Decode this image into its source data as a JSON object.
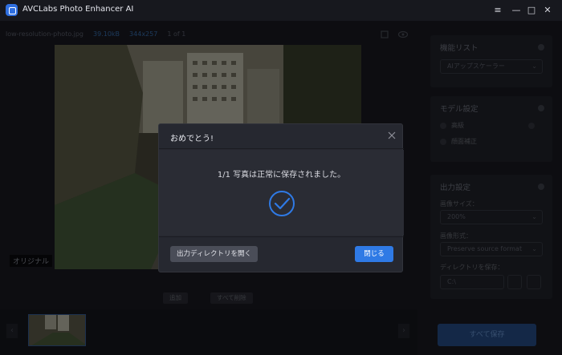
{
  "app": {
    "title": "AVCLabs Photo Enhancer AI"
  },
  "window": {
    "menu_icon": "hamburger-icon",
    "minimize_icon": "minimize-icon",
    "maximize_icon": "maximize-icon",
    "close_icon": "close-icon"
  },
  "file": {
    "name": "low-resolution-photo.jpg",
    "size": "39.10kB",
    "dimensions": "344x257",
    "page": "1 of 1"
  },
  "preview": {
    "label": "オリジナル"
  },
  "actions": {
    "add": "追加",
    "delete_all": "すべて削除"
  },
  "panel": {
    "model_list": {
      "title": "機能リスト",
      "selected": "AIアップスケーラー"
    },
    "model_settings": {
      "title": "モデル設定",
      "options": [
        "高級",
        "顔面補正"
      ]
    },
    "output": {
      "title": "出力設定",
      "scale_label": "画像サイズ：",
      "scale_value": "200%",
      "format_label": "画像形式：",
      "format_value": "Preserve source format",
      "dir_label": "ディレクトリを保存：",
      "dir_value": "C:\\"
    },
    "save_all": "すべて保存"
  },
  "dialog": {
    "title": "おめでとう!",
    "message": "1/1 写真は正常に保存されました。",
    "open_dir_button": "出力ディレクトリを開く",
    "close_button": "閉じる",
    "success_icon": "check-circle-icon"
  },
  "colors": {
    "accent": "#2f7ae5",
    "background": "#14151b",
    "dialog": "#262830"
  }
}
